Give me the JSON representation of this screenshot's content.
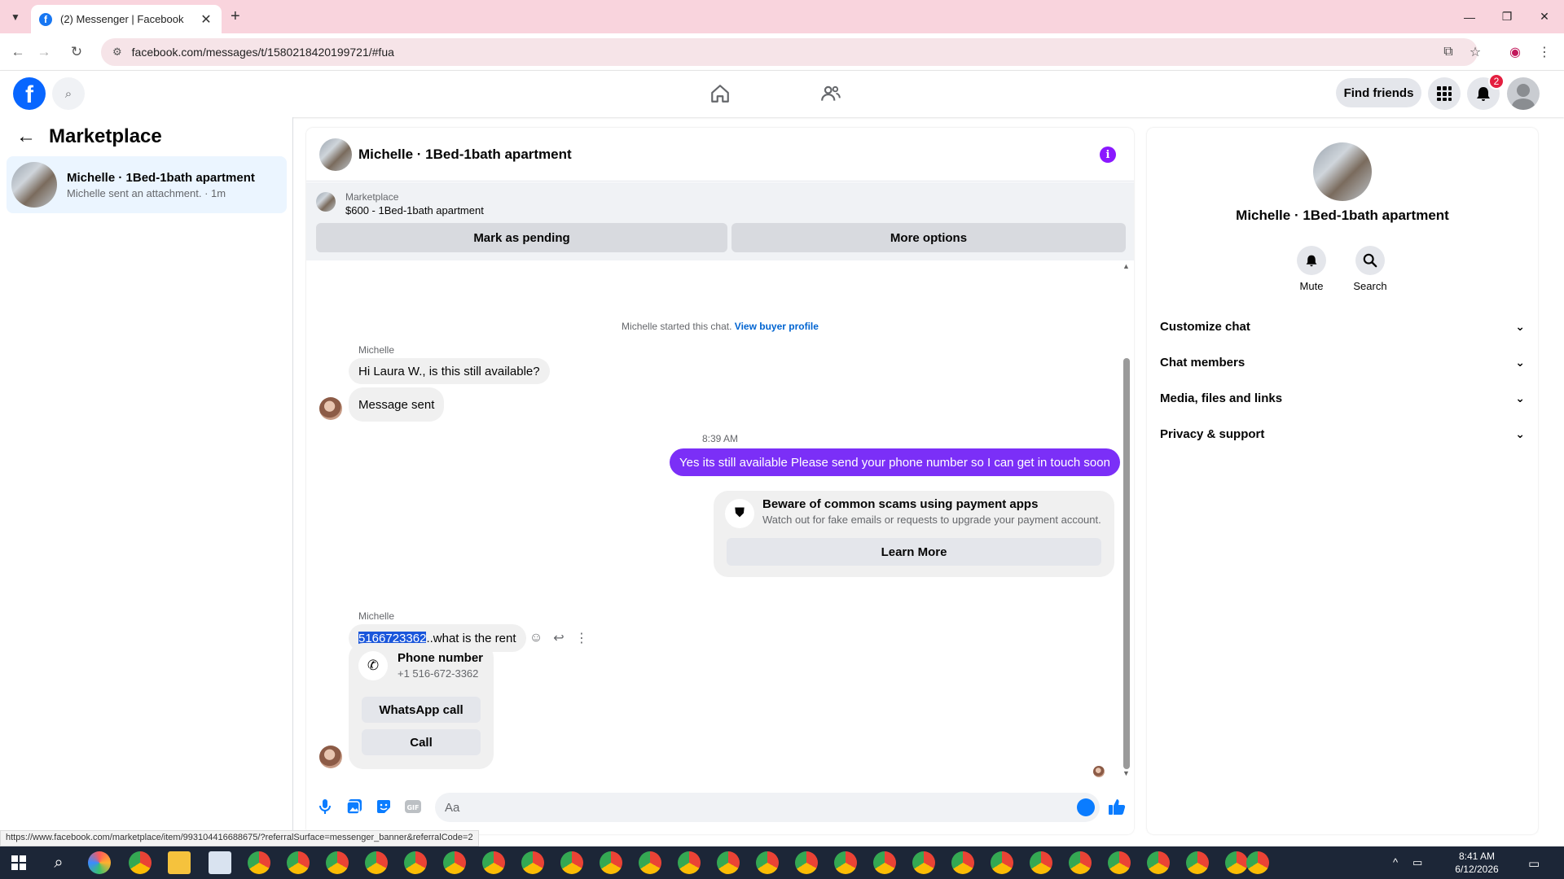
{
  "browser": {
    "tab_title": "(2) Messenger | Facebook",
    "url": "facebook.com/messages/t/1580218420199721/#fua",
    "status_url": "https://www.facebook.com/marketplace/item/993104416688675/?referralSurface=messenger_banner&referralCode=2"
  },
  "header": {
    "find_friends": "Find friends",
    "notif_count": "2"
  },
  "left": {
    "title": "Marketplace",
    "convo_name": "Michelle · 1Bed-1bath apartment",
    "convo_sub": "Michelle sent an attachment. · 1m"
  },
  "chat": {
    "title": "Michelle · 1Bed-1bath apartment",
    "banner_label": "Marketplace",
    "banner_item": "$600 - 1Bed-1bath apartment",
    "mark_pending": "Mark as pending",
    "more_options": "More options",
    "started_text": "Michelle started this chat.",
    "view_buyer": "View buyer profile",
    "sender1": "Michelle",
    "msg1": "Hi Laura W., is this still available?",
    "msg2": "Message sent",
    "time": "8:39 AM",
    "my_msg": "Yes its still available Please send your phone number so I can get in touch soon",
    "scam_title": "Beware of common scams using payment apps",
    "scam_text": "Watch out for fake emails or requests to upgrade your payment account.",
    "learn_more": "Learn More",
    "sender2": "Michelle",
    "msg3_highlight": "5166723362",
    "msg3_rest": "..what is the rent",
    "phone_title": "Phone number",
    "phone_value": "+1 516-672-3362",
    "whatsapp": "WhatsApp call",
    "call": "Call",
    "composer_placeholder": "Aa"
  },
  "info": {
    "name": "Michelle · 1Bed-1bath apartment",
    "mute": "Mute",
    "search": "Search",
    "sections": [
      "Customize chat",
      "Chat members",
      "Media, files and links",
      "Privacy & support"
    ]
  },
  "taskbar": {
    "time": "8:41 AM",
    "date": "6/12/2026"
  },
  "colors": {
    "fb_blue": "#0866ff",
    "my_bubble": "#7b2ff7",
    "selected_convo": "#ebf5ff",
    "tabbar": "#f9d4dd"
  }
}
